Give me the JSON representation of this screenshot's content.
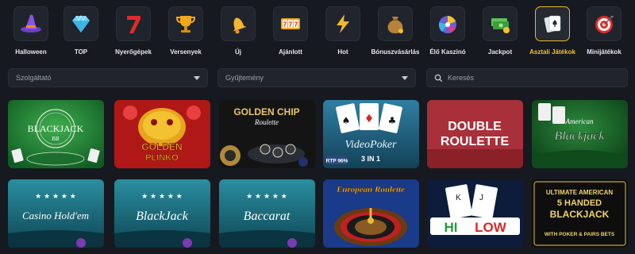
{
  "categories": [
    {
      "label": "Halloween",
      "icon": "witch-hat-icon"
    },
    {
      "label": "TOP",
      "icon": "diamond-icon"
    },
    {
      "label": "Nyerőgépek",
      "icon": "seven-icon"
    },
    {
      "label": "Versenyek",
      "icon": "trophy-icon"
    },
    {
      "label": "Új",
      "icon": "bell-icon"
    },
    {
      "label": "Ajánlott",
      "icon": "slot-777-icon"
    },
    {
      "label": "Hot",
      "icon": "lightning-icon"
    },
    {
      "label": "Bónuszvásárlás",
      "icon": "money-bag-icon"
    },
    {
      "label": "Élő Kaszinó",
      "icon": "wheel-icon"
    },
    {
      "label": "Jackpot",
      "icon": "cash-stack-icon"
    },
    {
      "label": "Asztali Játékok",
      "icon": "playing-cards-icon",
      "active": true
    },
    {
      "label": "Minijátékok",
      "icon": "target-icon"
    }
  ],
  "filters": {
    "provider_placeholder": "Szolgáltató",
    "collection_placeholder": "Gyűjtemény",
    "search_placeholder": "Keresés"
  },
  "games": {
    "row1": [
      {
        "title": "BLACKJACK",
        "sub": "BB"
      },
      {
        "title": "GOLDEN",
        "sub": "PLINKO"
      },
      {
        "title": "GOLDEN CHIP",
        "sub": "Roulette"
      },
      {
        "title": "VideoPoker",
        "sub": "3 IN 1",
        "badge": "RTP 96%"
      },
      {
        "title": "DOUBLE",
        "sub": "ROULETTE"
      },
      {
        "title": "American",
        "sub": "Blackjack"
      }
    ],
    "row2": [
      {
        "title": "Casino Hold'em"
      },
      {
        "title": "BlackJack"
      },
      {
        "title": "Baccarat"
      },
      {
        "title": "European Roulette"
      },
      {
        "title": "HI",
        "sub": "LOW"
      },
      {
        "title": "ULTIMATE AMERICAN",
        "sub": "5 HANDED",
        "sub2": "BLACKJACK",
        "sub3": "WITH POKER & PAIRS BETS"
      }
    ]
  },
  "colors": {
    "accent": "#f2c230",
    "background": "#16191f",
    "tile": "#20242c"
  }
}
